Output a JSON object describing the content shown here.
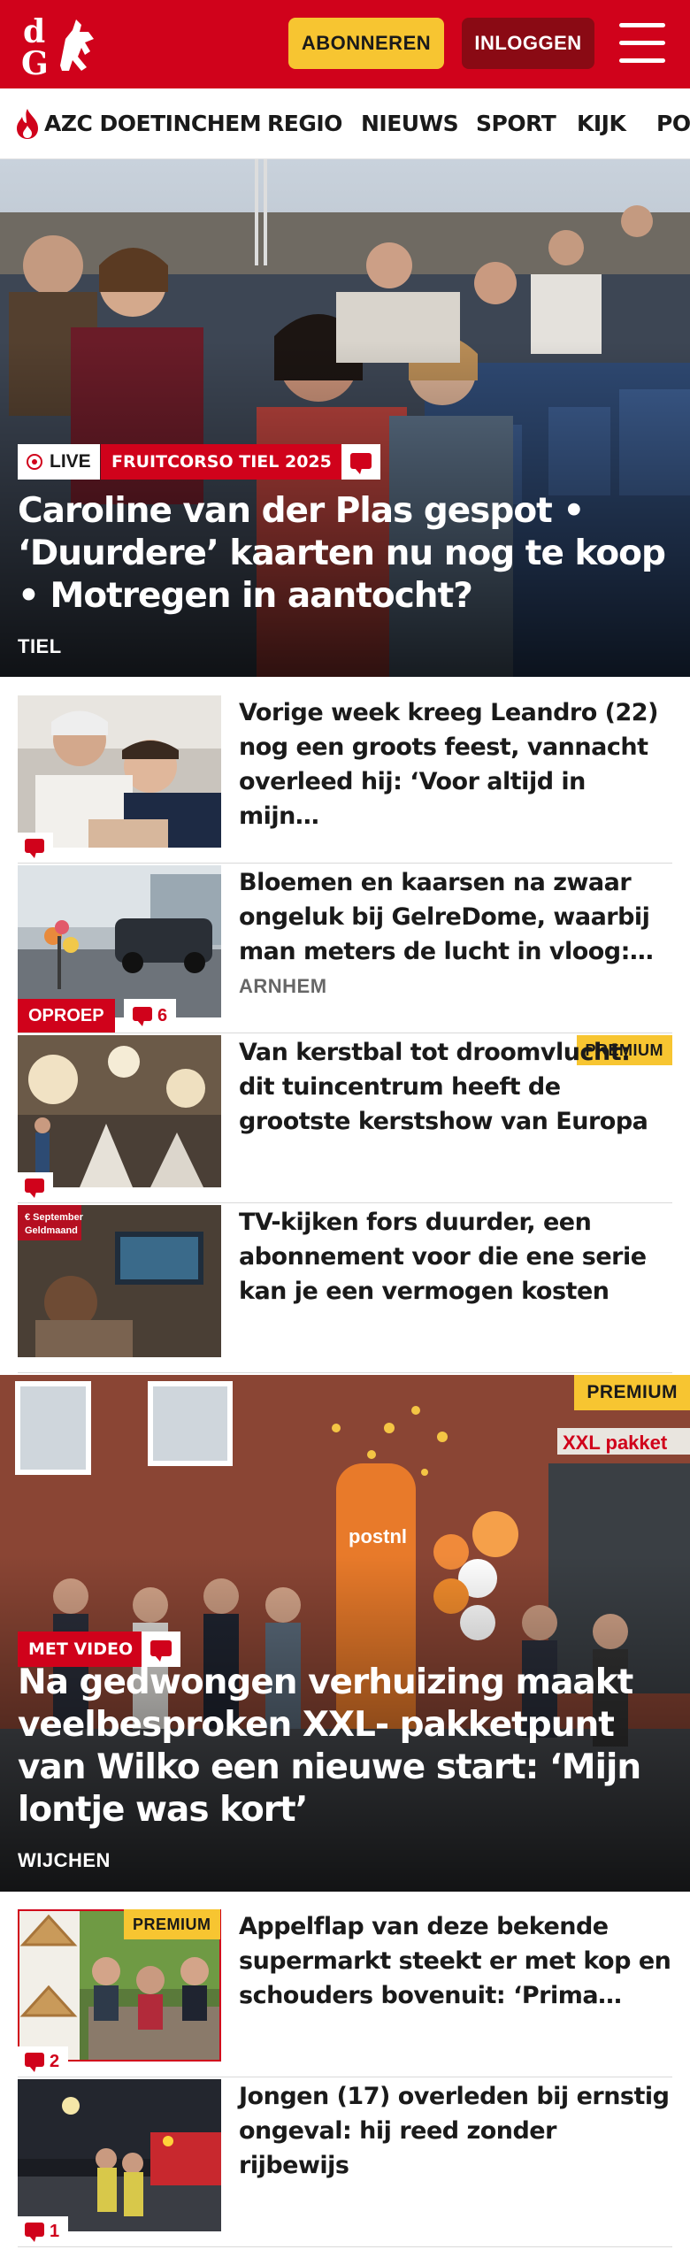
{
  "brand": {
    "name": "dG",
    "accent": "#d0021b",
    "yellow": "#f7c531"
  },
  "header": {
    "subscribe_label": "ABONNEREN",
    "login_label": "INLOGGEN",
    "menu_icon": "hamburger-icon"
  },
  "nav": {
    "items": [
      {
        "label": "AZC DOETINCHEM",
        "icon": "flame-icon"
      },
      {
        "label": "REGIO"
      },
      {
        "label": "NIEUWS"
      },
      {
        "label": "SPORT"
      },
      {
        "label": "KIJK"
      },
      {
        "label": "PO"
      }
    ]
  },
  "hero1": {
    "live_label": "LIVE",
    "tag": "FRUITCORSO TIEL 2025",
    "title": "Caroline van der Plas gespot • ‘Duurdere’ kaarten nu nog te koop • Motregen in aantocht?",
    "location": "TIEL"
  },
  "list1": [
    {
      "title": "Vorige week kreeg Leandro (22) nog een groots feest, vannacht overleed hij: ‘Voor altijd in mijn…",
      "comment_icon": true
    },
    {
      "title": "Bloemen en kaarsen na zwaar ongeluk bij GelreDome, waarbij man meters de lucht in vloog:…",
      "location": "ARNHEM",
      "label": "OPROEP",
      "comments": "6"
    },
    {
      "title": "Van kerstbal tot droomvlucht: dit tuincentrum heeft de grootste kerstshow van Europa",
      "premium": "PREMIUM",
      "comment_icon": true
    },
    {
      "title": "TV-kijken fors duurder, een abonnement voor die ene serie kan je een vermogen kosten",
      "badge": "€ September Geldmaand"
    }
  ],
  "hero2": {
    "premium": "PREMIUM",
    "tag": "MET VIDEO",
    "title": "Na gedwongen verhuizing maakt veelbesproken XXL- pakketpunt van Wilko een nieuwe start: ‘Mijn lontje was kort’",
    "location": "WIJCHEN",
    "sign": "XXL pakket",
    "brand_sign": "postnl"
  },
  "list2": [
    {
      "title": "Appelflap van deze bekende supermarkt steekt er met kop en schouders bovenuit: ‘Prima…",
      "premium": "PREMIUM",
      "comments": "2"
    },
    {
      "title": "Jongen (17) overleden bij ernstig ongeval: hij reed zonder rijbewijs",
      "comments": "1"
    }
  ]
}
